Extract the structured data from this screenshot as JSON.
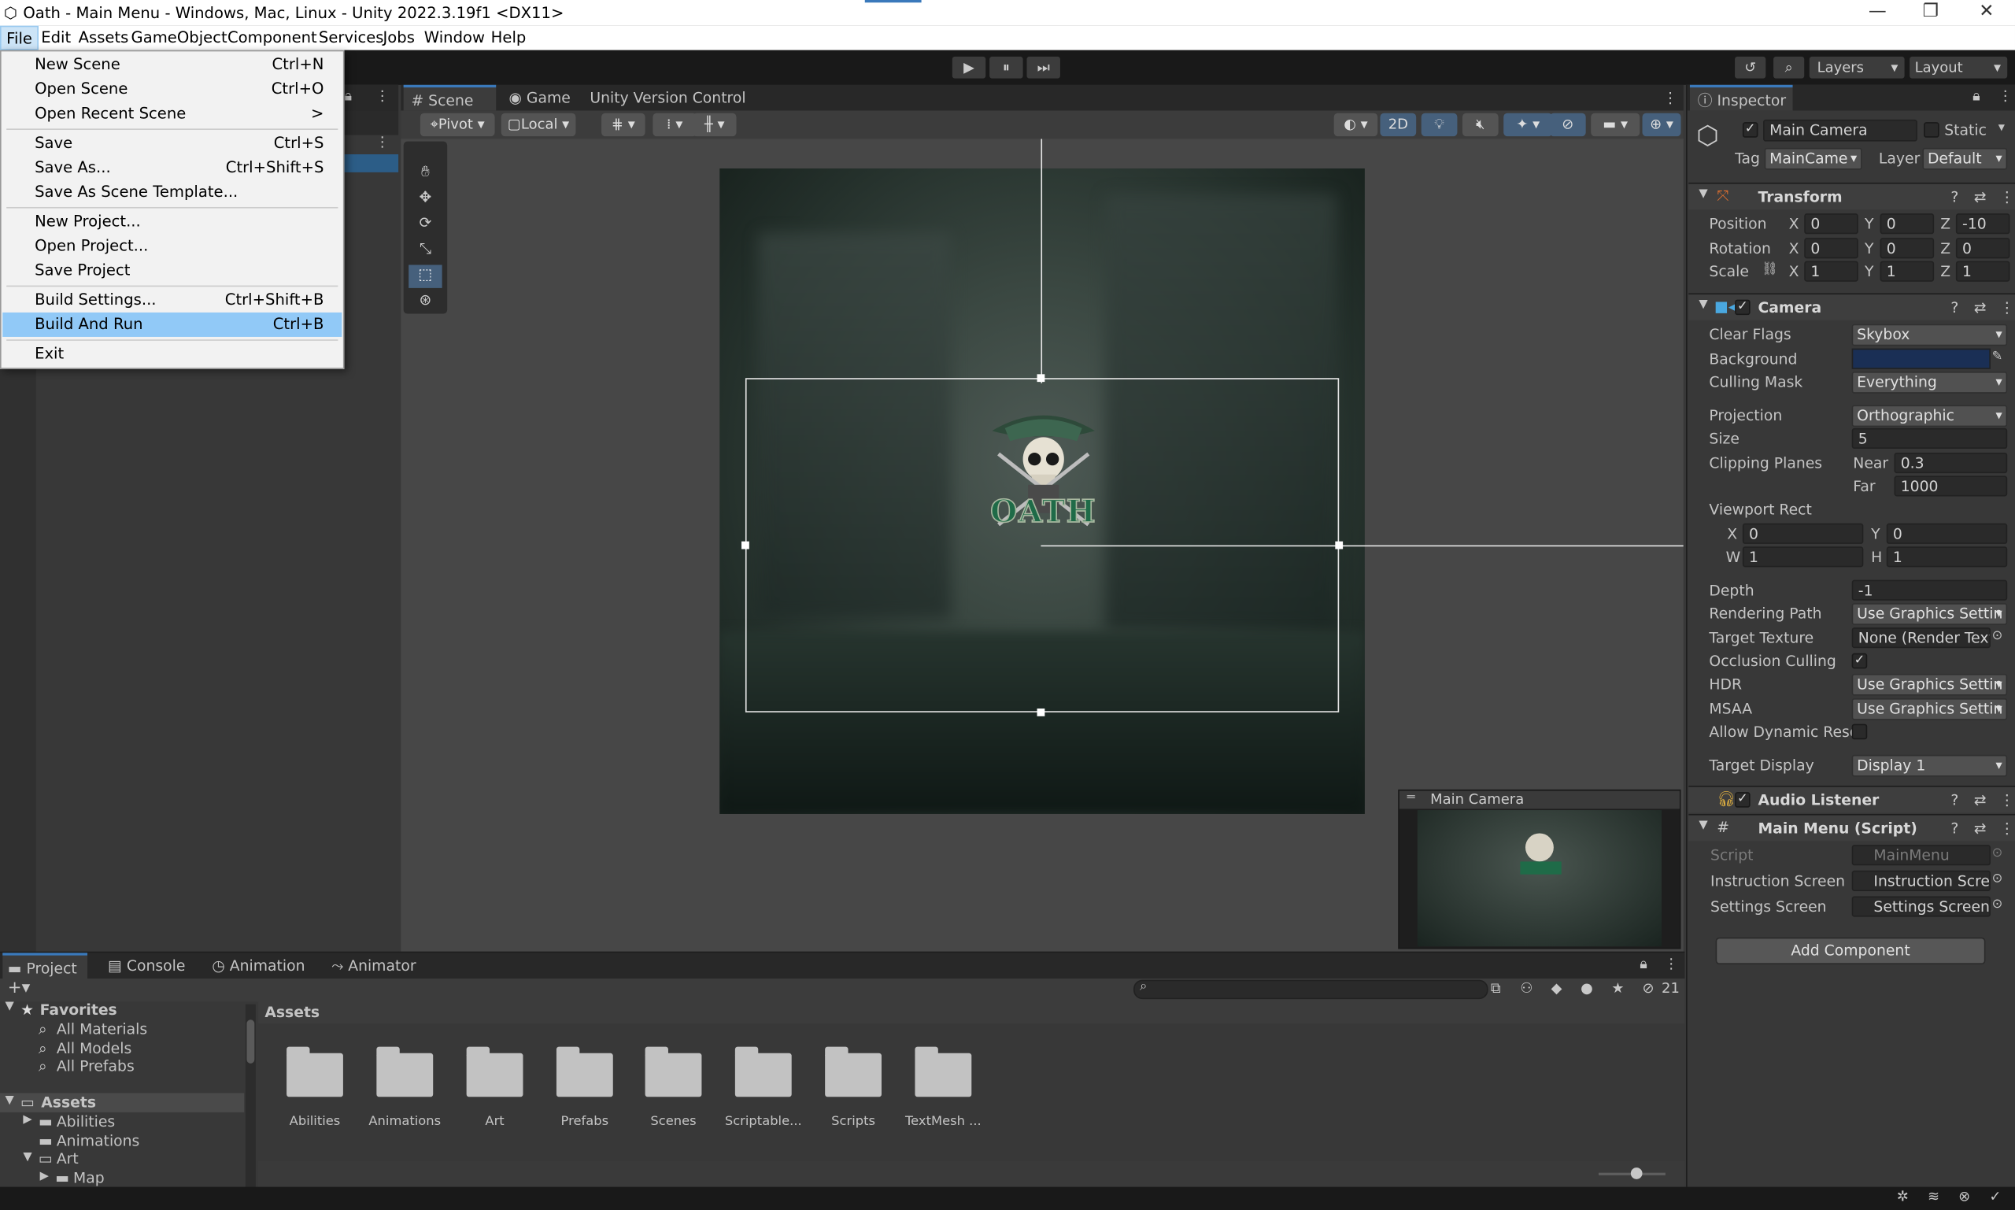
{
  "window": {
    "title": "Oath - Main Menu - Windows, Mac, Linux - Unity 2022.3.19f1 <DX11>",
    "minimize": "—",
    "maximize": "❐",
    "close": "✕"
  },
  "menubar": [
    "File",
    "Edit",
    "Assets",
    "GameObject",
    "Component",
    "Services",
    "Jobs",
    "Window",
    "Help"
  ],
  "file_menu": {
    "items": [
      {
        "label": "New Scene",
        "shortcut": "Ctrl+N"
      },
      {
        "label": "Open Scene",
        "shortcut": "Ctrl+O"
      },
      {
        "label": "Open Recent Scene",
        "shortcut": ">"
      },
      {
        "label": "Save",
        "shortcut": "Ctrl+S"
      },
      {
        "label": "Save As...",
        "shortcut": "Ctrl+Shift+S"
      },
      {
        "label": "Save As Scene Template...",
        "shortcut": ""
      },
      {
        "label": "New Project...",
        "shortcut": ""
      },
      {
        "label": "Open Project...",
        "shortcut": ""
      },
      {
        "label": "Save Project",
        "shortcut": ""
      },
      {
        "label": "Build Settings...",
        "shortcut": "Ctrl+Shift+B"
      },
      {
        "label": "Build And Run",
        "shortcut": "Ctrl+B",
        "highlighted": true
      },
      {
        "label": "Exit",
        "shortcut": ""
      }
    ]
  },
  "toolbar": {
    "play": "▶",
    "pause": "⏸",
    "step": "⏭",
    "layers": "Layers",
    "layout": "Layout"
  },
  "scene_tabs": [
    "Scene",
    "Game",
    "Unity Version Control"
  ],
  "scene_toolbar": {
    "pivot": "Pivot",
    "local": "Local",
    "mode_2d": "2D"
  },
  "scene_view": {
    "logo_text": "OATH",
    "camera_preview_title": "Main Camera"
  },
  "inspector": {
    "tab": "Inspector",
    "object_name": "Main Camera",
    "static_label": "Static",
    "tag_label": "Tag",
    "tag_value": "MainCame",
    "layer_label": "Layer",
    "layer_value": "Default",
    "transform": {
      "title": "Transform",
      "position": {
        "label": "Position",
        "x": "0",
        "y": "0",
        "z": "-10"
      },
      "rotation": {
        "label": "Rotation",
        "x": "0",
        "y": "0",
        "z": "0"
      },
      "scale": {
        "label": "Scale",
        "x": "1",
        "y": "1",
        "z": "1"
      }
    },
    "camera": {
      "title": "Camera",
      "clear_flags": {
        "label": "Clear Flags",
        "value": "Skybox"
      },
      "background": {
        "label": "Background",
        "color": "#1a2f55"
      },
      "culling_mask": {
        "label": "Culling Mask",
        "value": "Everything"
      },
      "projection": {
        "label": "Projection",
        "value": "Orthographic"
      },
      "size": {
        "label": "Size",
        "value": "5"
      },
      "clipping": {
        "label": "Clipping Planes",
        "near_label": "Near",
        "near": "0.3",
        "far_label": "Far",
        "far": "1000"
      },
      "viewport": {
        "label": "Viewport Rect",
        "x": "0",
        "y": "0",
        "w": "1",
        "h": "1"
      },
      "depth": {
        "label": "Depth",
        "value": "-1"
      },
      "rendering_path": {
        "label": "Rendering Path",
        "value": "Use Graphics Settin"
      },
      "target_texture": {
        "label": "Target Texture",
        "value": "None (Render Textu"
      },
      "occlusion": {
        "label": "Occlusion Culling"
      },
      "hdr": {
        "label": "HDR",
        "value": "Use Graphics Settin"
      },
      "msaa": {
        "label": "MSAA",
        "value": "Use Graphics Settin"
      },
      "dynamic_res": {
        "label": "Allow Dynamic Reso"
      },
      "target_display": {
        "label": "Target Display",
        "value": "Display 1"
      }
    },
    "audio_listener": {
      "title": "Audio Listener"
    },
    "main_menu_script": {
      "title": "Main Menu (Script)",
      "script": {
        "label": "Script",
        "value": "MainMenu"
      },
      "instruction": {
        "label": "Instruction Screen",
        "value": "Instruction Scree"
      },
      "settings": {
        "label": "Settings Screen",
        "value": "Settings Screen"
      }
    },
    "add_component": "Add Component"
  },
  "bottom_tabs": [
    "Project",
    "Console",
    "Animation",
    "Animator"
  ],
  "project": {
    "hidden_count": "21",
    "favorites": "Favorites",
    "fav_items": [
      "All Materials",
      "All Models",
      "All Prefabs"
    ],
    "assets_root": "Assets",
    "tree": [
      "Abilities",
      "Animations",
      "Art",
      "Map"
    ],
    "breadcrumb": "Assets",
    "folders": [
      "Abilities",
      "Animations",
      "Art",
      "Prefabs",
      "Scenes",
      "Scriptable...",
      "Scripts",
      "TextMesh ..."
    ]
  }
}
